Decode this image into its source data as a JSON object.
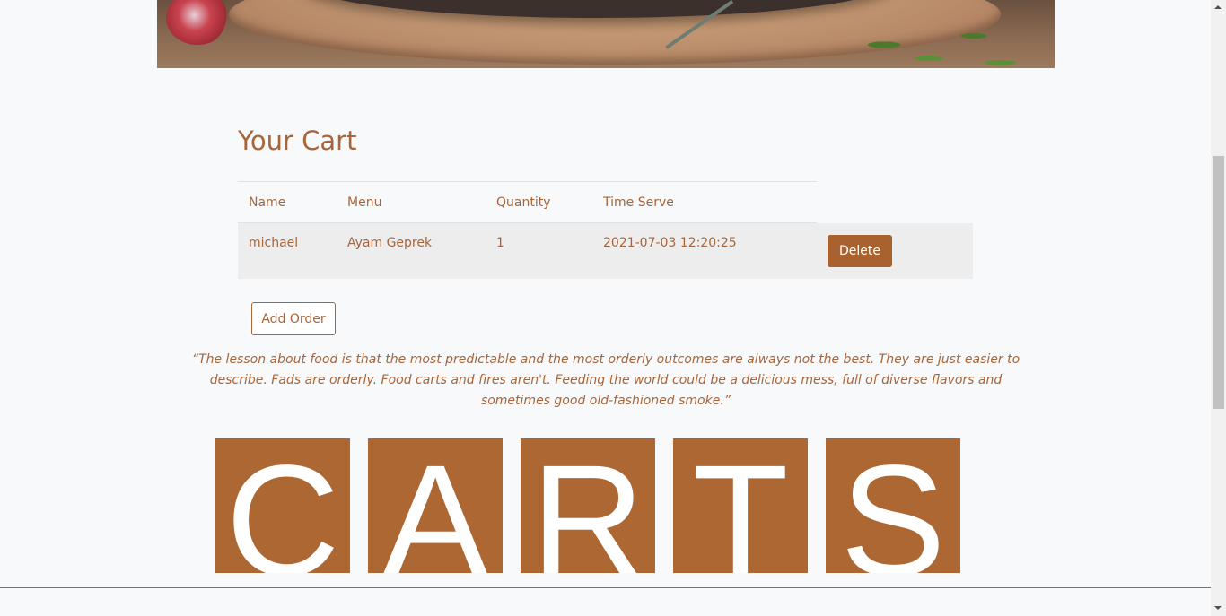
{
  "cart": {
    "title": "Your Cart",
    "columns": [
      "Name",
      "Menu",
      "Quantity",
      "Time Serve"
    ],
    "rows": [
      {
        "name": "michael",
        "menu": "Ayam Geprek",
        "quantity": "1",
        "time_serve": "2021-07-03 12:20:25",
        "delete_label": "Delete"
      }
    ],
    "add_order_label": "Add Order"
  },
  "quote": "“The lesson about food is that the most predictable and the most orderly outcomes are always not the best. They are just easier to describe. Fads are orderly. Food carts and fires aren't. Feeding the world could be a delicious mess, full of diverse flavors and sometimes good old-fashioned smoke.”",
  "tiles": {
    "letters": [
      "C",
      "A",
      "R",
      "T",
      "S"
    ]
  },
  "colors": {
    "accent": "#a8653a",
    "tile": "#ad6733",
    "button": "#a8622f",
    "background": "#f8f9fb"
  }
}
